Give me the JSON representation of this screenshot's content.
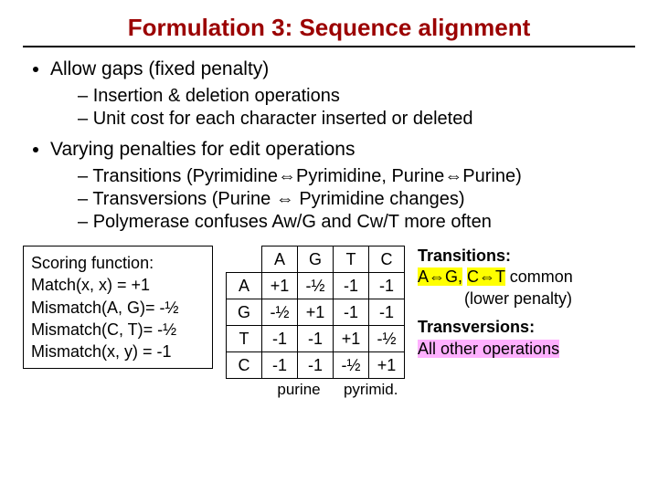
{
  "title": "Formulation 3: Sequence alignment",
  "bullets": {
    "b1": "Allow gaps (fixed penalty)",
    "b1a": "Insertion & deletion operations",
    "b1b": "Unit cost for each character inserted or deleted",
    "b2": "Varying penalties for edit operations",
    "b2a": "Transitions (Pyrimidine⇔Pyrimidine, Purine⇔Purine)",
    "b2b": "Transversions (Purine ⇔ Pyrimidine changes)",
    "b2c": "Polymerase confuses Aw/G and Cw/T more often"
  },
  "scoring": {
    "l1": "Scoring function:",
    "l2": "Match(x, x) = +1",
    "l3": "Mismatch(A, G)= -½",
    "l4": "Mismatch(C, T)= -½",
    "l5": "Mismatch(x, y) = -1"
  },
  "matrix": {
    "cols": [
      "A",
      "G",
      "T",
      "C"
    ],
    "rows": [
      "A",
      "G",
      "T",
      "C"
    ],
    "cells": [
      [
        "+1",
        "-½",
        "-1",
        "-1"
      ],
      [
        "-½",
        "+1",
        "-1",
        "-1"
      ],
      [
        "-1",
        "-1",
        "+1",
        "-½"
      ],
      [
        "-1",
        "-1",
        "-½",
        "+1"
      ]
    ],
    "foot_left": "purine",
    "foot_right": "pyrimid."
  },
  "notes": {
    "n1": "Transitions:",
    "n2a": "A⇔G,",
    "n2b": "C⇔T",
    "n2c": " common",
    "n3": "(lower penalty)",
    "n4": "Transversions:",
    "n5": "All other operations"
  }
}
